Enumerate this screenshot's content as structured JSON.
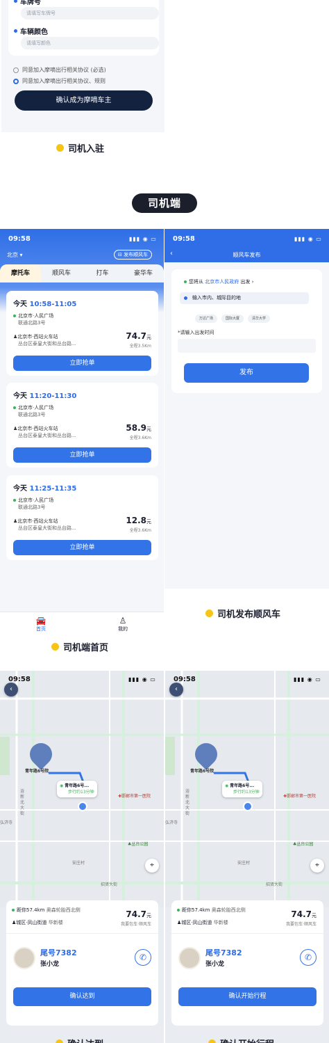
{
  "form": {
    "field_plate_label": "车牌号",
    "field_plate_placeholder": "请填写车牌号",
    "field_color_label": "车辆颜色",
    "field_color_placeholder": "请填写颜色",
    "agree_1": "同意加入摩嘀出行相关协议 (必选)",
    "agree_2": "同意加入摩嘀出行相关协议、规则",
    "confirm_button": "确认成为摩嘀车主"
  },
  "captions": {
    "driver_join": "司机入驻",
    "section_pill": "司机端",
    "driver_home": "司机端首页",
    "publish_ride": "司机发布顺风车",
    "confirm_arrival": "确认达到",
    "confirm_start": "确认开始行程"
  },
  "home": {
    "time": "09:58",
    "status_icons": "▮▮▮ ◉ ▭",
    "city": "北京",
    "publish_pill": "发布顺风车",
    "tabs": [
      "摩托车",
      "顺风车",
      "打车",
      "豪华车"
    ],
    "orders": [
      {
        "day": "今天",
        "time": "10:58-11:05",
        "from": "北京市·人民广场",
        "from_sub": "联通北路3号",
        "to": "北京市·西站火车站",
        "to_sub": "丛台区泰皇大街和丛台路...",
        "price": "74.7",
        "unit": "元",
        "dist": "全程3.5Km",
        "button": "立即抢单"
      },
      {
        "day": "今天",
        "time": "11:20-11:30",
        "from": "北京市·人民广场",
        "from_sub": "联通北路3号",
        "to": "北京市·西站火车站",
        "to_sub": "丛台区泰皇大街和丛台路...",
        "price": "58.9",
        "unit": "元",
        "dist": "全程3.6Km",
        "button": "立即抢单"
      },
      {
        "day": "今天",
        "time": "11:25-11:35",
        "from": "北京市·人民广场",
        "from_sub": "联通北路3号",
        "to": "北京市·西站火车站",
        "to_sub": "丛台区泰皇大街和丛台路...",
        "price": "12.8",
        "unit": "元",
        "dist": "全程3.6Km",
        "button": "立即抢单"
      }
    ],
    "nav": [
      {
        "label": "首页",
        "icon": "car-icon"
      },
      {
        "label": "我的",
        "icon": "user-icon"
      }
    ]
  },
  "publish": {
    "time": "09:58",
    "title": "顺风车发布",
    "from_prefix": "您将从",
    "from_place": "北京市人民政府",
    "from_suffix": "出发",
    "dest_placeholder": "输入市内、城际目的地",
    "chips": [
      "万达广场",
      "国际大厦",
      "清华大学"
    ],
    "time_label": "*请输入出发时间",
    "submit": "发布"
  },
  "nav_screens": [
    {
      "time": "09:58",
      "pin_label": "青年路6号院",
      "callout_title": "青年路6号...",
      "callout_sub": "步行约13分钟",
      "poi_hospital": "邯郸市第一医院",
      "poi_park": "丛台公园",
      "poi_village": "安庄村",
      "poi_street": "招贤大街",
      "poi_left": "浴新北大街",
      "poi_temple": "弘济寺",
      "distance": "距你57.4km",
      "place": "奥森轮胎西北侧",
      "district": "城区·凤山街道",
      "building": "华新楼",
      "price": "74.7",
      "unit": "元",
      "ride_type": "我要包车·顺风车",
      "plate": "尾号7382",
      "driver": "张小龙",
      "button": "确认达到"
    },
    {
      "time": "09:58",
      "pin_label": "青年路6号院",
      "callout_title": "青年路6号...",
      "callout_sub": "步行约13分钟",
      "poi_hospital": "邯郸市第一医院",
      "poi_park": "丛台公园",
      "poi_village": "安庄村",
      "poi_street": "招贤大街",
      "poi_left": "浴新北大街",
      "poi_temple": "弘济寺",
      "distance": "距你57.4km",
      "place": "奥森轮胎西北侧",
      "district": "城区·凤山街道",
      "building": "华新楼",
      "price": "74.7",
      "unit": "元",
      "ride_type": "我要包车·顺风车",
      "plate": "尾号7382",
      "driver": "张小龙",
      "button": "确认开始行程"
    }
  ],
  "colors": {
    "primary": "#3273e8",
    "navy": "#13223f",
    "accent_yellow": "#f7c514",
    "green": "#3cb35a"
  }
}
